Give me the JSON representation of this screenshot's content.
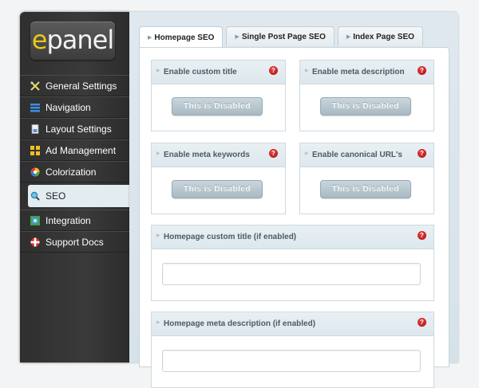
{
  "logo": {
    "first_letter": "e",
    "rest": "panel"
  },
  "sidebar": {
    "items": [
      {
        "label": "General Settings",
        "icon": "tools-icon"
      },
      {
        "label": "Navigation",
        "icon": "list-icon"
      },
      {
        "label": "Layout Settings",
        "icon": "page-icon"
      },
      {
        "label": "Ad Management",
        "icon": "grid-icon"
      },
      {
        "label": "Colorization",
        "icon": "color-wheel-icon"
      },
      {
        "label": "SEO",
        "icon": "magnifier-icon"
      },
      {
        "label": "Integration",
        "icon": "integration-icon"
      },
      {
        "label": "Support Docs",
        "icon": "lifebuoy-icon"
      }
    ],
    "active": "SEO"
  },
  "tabs": [
    {
      "label": "Homepage SEO",
      "active": true
    },
    {
      "label": "Single Post Page SEO",
      "active": false
    },
    {
      "label": "Index Page SEO",
      "active": false
    }
  ],
  "options": {
    "custom_title": {
      "label": "Enable custom title",
      "button": "This is Disabled"
    },
    "meta_description": {
      "label": "Enable meta description",
      "button": "This is Disabled"
    },
    "meta_keywords": {
      "label": "Enable meta keywords",
      "button": "This is Disabled"
    },
    "canonical": {
      "label": "Enable canonical URL's",
      "button": "This is Disabled"
    }
  },
  "fields": {
    "homepage_title": {
      "label": "Homepage custom title (if enabled)",
      "value": ""
    },
    "homepage_description": {
      "label": "Homepage meta description (if enabled)",
      "value": ""
    }
  },
  "help_symbol": "?",
  "colors": {
    "accent_yellow": "#e7c51d",
    "help_red": "#c01818",
    "sidebar_dark": "#333333"
  }
}
